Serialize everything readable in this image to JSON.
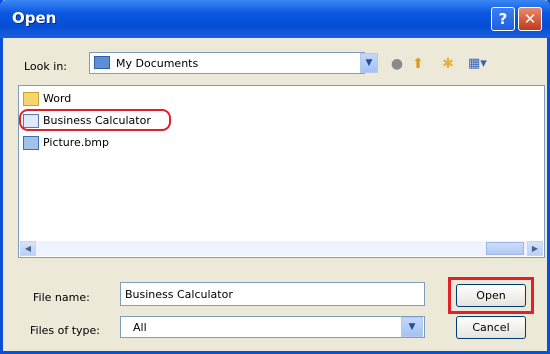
{
  "window": {
    "title": "Open",
    "help_label": "?",
    "close_label": "✕"
  },
  "lookin": {
    "label": "Look in:",
    "value": "My Documents"
  },
  "toolbar": {
    "back_icon": "back-arrow-icon",
    "up_icon": "up-folder-icon",
    "new_folder_icon": "new-folder-icon",
    "views_icon": "views-menu-icon"
  },
  "files": [
    {
      "name": "Word",
      "type": "folder"
    },
    {
      "name": "Business Calculator",
      "type": "file"
    },
    {
      "name": "Picture.bmp",
      "type": "image"
    }
  ],
  "filename": {
    "label": "File name:",
    "value": "Business Calculator"
  },
  "filetype": {
    "label": "Files of type:",
    "value": "All"
  },
  "buttons": {
    "open": "Open",
    "cancel": "Cancel"
  },
  "colors": {
    "title_bar": "#0a57e0",
    "highlight": "#e2202a",
    "dialog_bg": "#ece9d8"
  }
}
